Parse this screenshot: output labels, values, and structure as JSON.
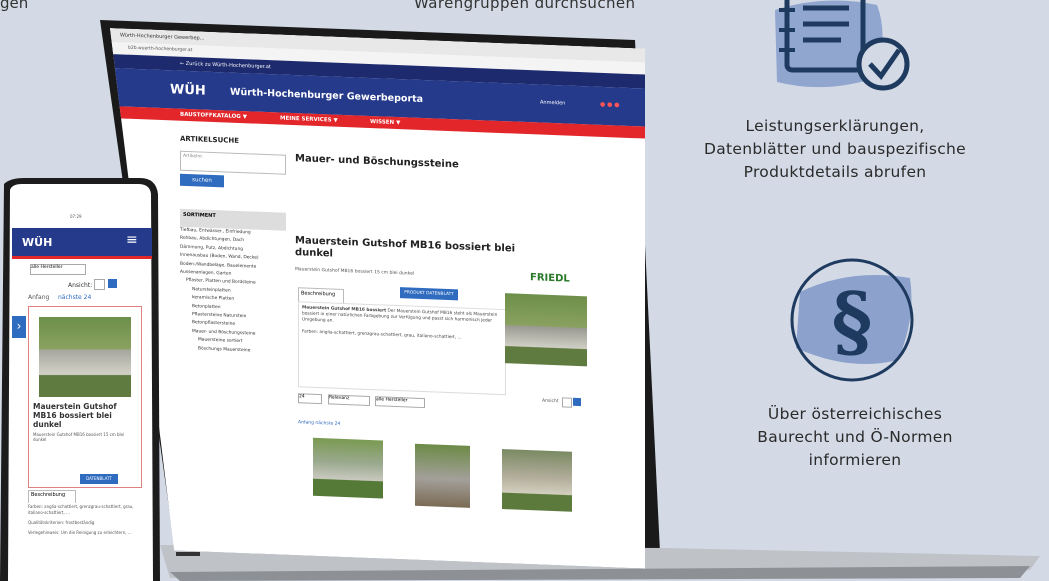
{
  "captions": {
    "top_left_fragment": "gen",
    "top_middle": "Warengruppen durchsuchen",
    "feature_declarations": [
      "Leistungserklärungen,",
      "Datenblätter und bauspezifische",
      "Produktdetails abrufen"
    ],
    "feature_law": [
      "Über österreichisches",
      "Baurecht und Ö-Normen",
      "informieren"
    ]
  },
  "browser": {
    "tab_title": "Würth-Hochenburger Gewerbep...",
    "url": "b2b.wuerth-hochenburger.at",
    "back_link": "← Zurück zu Würth-Hochenburger.at",
    "logo": "WÜH",
    "portal_title": "Würth-Hochenburger Gewerbeporta",
    "login": "Anmelden",
    "nav": [
      "BAUSTOFFKATALOG ▼",
      "MEINE SERVICES ▼",
      "WISSEN ▼"
    ],
    "search_heading": "ARTIKELSUCHE",
    "search_placeholder": "Artikelnr.",
    "search_button": "suchen",
    "sortiment_heading": "SORTIMENT",
    "sortiment": [
      "Tiefbau, Entwässer., Einfriedung",
      "Rohbau, Abdichtungen, Dach",
      "Dämmung, Putz, Abdichtung",
      "Innenausbau (Boden, Wand, Decke)",
      "Boden-/Wandbeläge, Bauelemente",
      "Aussenanlagen, Garten",
      "Pflaster, Platten und Bordsteine",
      "Natursteinplatten",
      "keramische Platten",
      "Betonplatten",
      "Pflastersteine Naturstein",
      "Betonpflastersteine",
      "Mauer- und Böschungssteine",
      "Mauersteine sortiert",
      "Böschungs Mauersteine"
    ],
    "category_title": "Mauer- und Böschungssteine",
    "product_title_1": "Mauerstein Gutshof MB16 bossiert blei",
    "product_title_2": "dunkel",
    "product_sub": "Mauerstein Gutshof MB16 bossiert 15 cm blei dunkel",
    "brand": "FRIEDL",
    "tab_label": "Beschreibung",
    "datasheet_button": "PRODUKT DATENBLATT",
    "desc_lead": "Mauerstein Gutshof MB16 bossiert",
    "desc": "Der Mauerstein Gutshof MB16 steht als Mauerstein bossiert in einer natürlichen Farbgebung zur Verfügung und passt sich harmonisch jeder Umgebung an.",
    "colors_text": "Farben: anglia-schattiert, grenzgrau-schattiert, grau, italiano-schattiert, ...",
    "per_page": "24",
    "sort": "Relevanz",
    "producer": "alle Hersteller",
    "view_label": "Ansicht",
    "pager": "Anfang  nächste 24"
  },
  "phone": {
    "time": "07:29",
    "logo": "WÜH",
    "filter": "alle Hersteller",
    "view_label": "Ansicht:",
    "pager_start": "Anfang",
    "pager_next": "nächste 24",
    "product_title": "Mauerstein Gutshof MB16 bossiert blei dunkel",
    "product_sub": "Mauerstein Gutshof MB16 bossiert 15 cm blei dunkel",
    "button": "DATENBLATT",
    "tab": "Beschreibung",
    "text1": "Farben: anglia-schattiert, grenzgrau-schattiert, grau, italiano-schattiert, ...",
    "text2": "Qualitätskriterien: frostbeständig",
    "text3": "Verlegehinweis: Um die Reinigung zu erleichtern, ..."
  },
  "colors": {
    "navy": "#263a8c",
    "red": "#e2262a",
    "icon": "#1e3a5f",
    "brush": "#7f98c8"
  }
}
